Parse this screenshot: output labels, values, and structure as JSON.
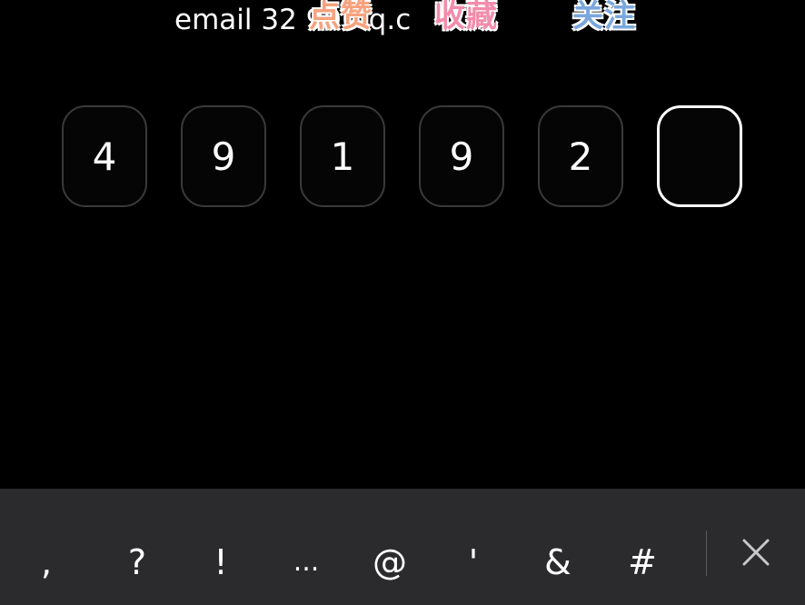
{
  "header": {
    "email_text": "email 32   990   q.c"
  },
  "stickers": [
    "点赞",
    "收藏",
    "关注"
  ],
  "otp": {
    "digits": [
      "4",
      "9",
      "1",
      "9",
      "2",
      ""
    ],
    "active_index": 5
  },
  "keyboard": {
    "keys": [
      ",",
      "?",
      "!",
      "...",
      "@",
      "'",
      "&",
      "#"
    ],
    "close_icon": "close-icon"
  },
  "colors": {
    "background": "#000000",
    "keyboard_bg": "#2b2b2d",
    "box_border": "#3a3a3c",
    "active_border": "#ffffff"
  }
}
